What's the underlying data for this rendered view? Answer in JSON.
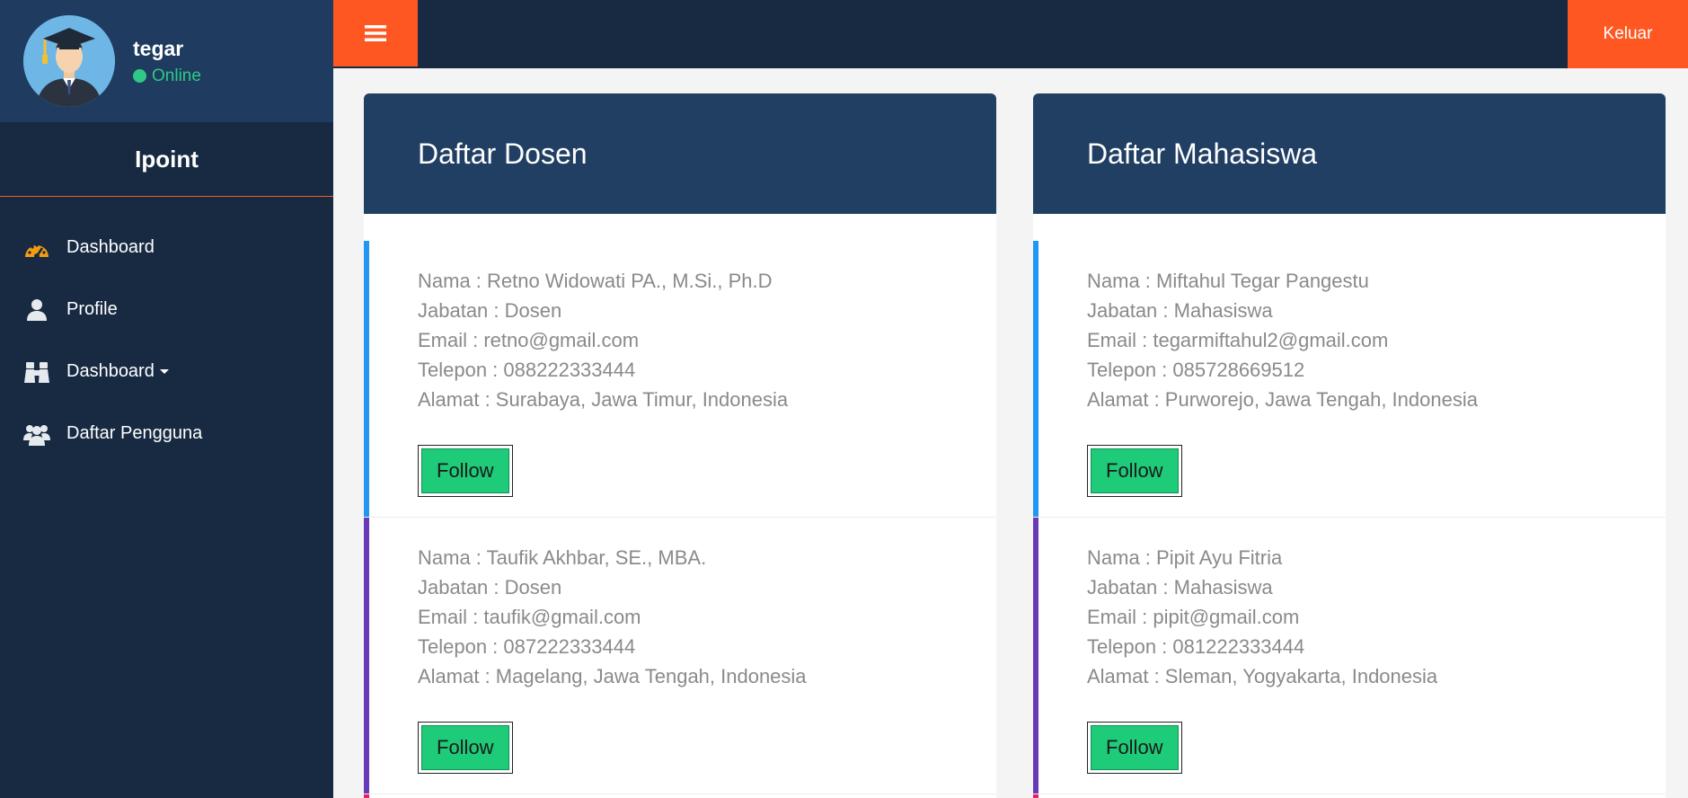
{
  "user": {
    "name": "tegar",
    "status": "Online"
  },
  "brand": "Ipoint",
  "menu": [
    {
      "label": "Dashboard",
      "icon": "dashboard-icon"
    },
    {
      "label": "Profile",
      "icon": "user-icon"
    },
    {
      "label": "Dashboard",
      "icon": "binoculars-icon",
      "dropdown": true
    },
    {
      "label": "Daftar Pengguna",
      "icon": "users-icon"
    }
  ],
  "topbar": {
    "logout_label": "Keluar"
  },
  "colors": {
    "accent": "#ff5722",
    "sidebar": "#172a42",
    "header": "#213f63",
    "follow": "#1ecb78",
    "online": "#2ec987"
  },
  "dosen": {
    "title": "Daftar Dosen",
    "entries": [
      {
        "nama": "Nama : Retno Widowati PA., M.Si., Ph.D",
        "jabatan": "Jabatan : Dosen",
        "email": "Email : retno@gmail.com",
        "telepon": "Telepon : 088222333444",
        "alamat": "Alamat : Surabaya, Jawa Timur, Indonesia",
        "button": "Follow",
        "bar_color": "#2196f3"
      },
      {
        "nama": "Nama : Taufik Akhbar, SE., MBA.",
        "jabatan": "Jabatan : Dosen",
        "email": "Email : taufik@gmail.com",
        "telepon": "Telepon : 087222333444",
        "alamat": "Alamat : Magelang, Jawa Tengah, Indonesia",
        "button": "Follow",
        "bar_color": "#673ab7"
      }
    ]
  },
  "mahasiswa": {
    "title": "Daftar Mahasiswa",
    "entries": [
      {
        "nama": "Nama : Miftahul Tegar Pangestu",
        "jabatan": "Jabatan : Mahasiswa",
        "email": "Email : tegarmiftahul2@gmail.com",
        "telepon": "Telepon : 085728669512",
        "alamat": "Alamat : Purworejo, Jawa Tengah, Indonesia",
        "button": "Follow",
        "bar_color": "#2196f3"
      },
      {
        "nama": "Nama : Pipit Ayu Fitria",
        "jabatan": "Jabatan : Mahasiswa",
        "email": "Email : pipit@gmail.com",
        "telepon": "Telepon : 081222333444",
        "alamat": "Alamat : Sleman, Yogyakarta, Indonesia",
        "button": "Follow",
        "bar_color": "#673ab7"
      }
    ]
  }
}
